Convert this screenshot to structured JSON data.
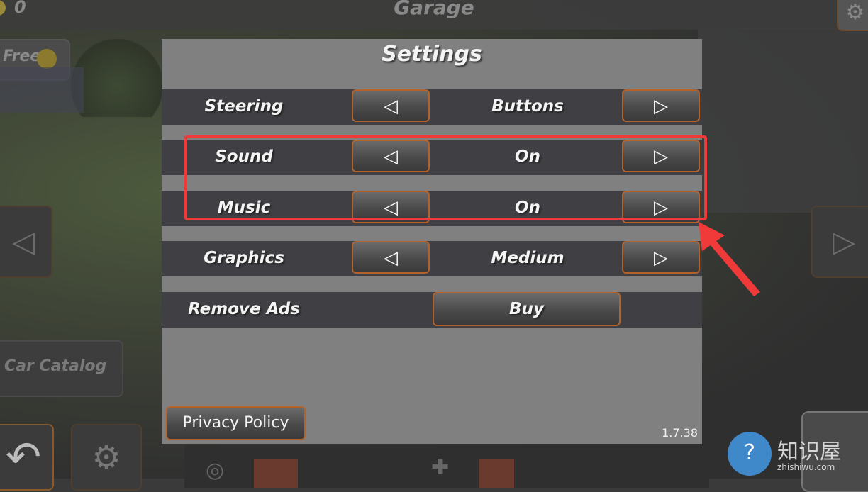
{
  "header": {
    "title": "Garage",
    "coins": "0"
  },
  "left": {
    "free_label": "Free",
    "car_catalog_label": "Car Catalog"
  },
  "settings": {
    "title": "Settings",
    "rows": [
      {
        "label": "Steering",
        "value": "Buttons"
      },
      {
        "label": "Sound",
        "value": "On"
      },
      {
        "label": "Music",
        "value": "On"
      },
      {
        "label": "Graphics",
        "value": "Medium"
      }
    ],
    "remove_ads_label": "Remove Ads",
    "buy_label": "Buy",
    "privacy_label": "Privacy Policy",
    "version": "1.7.38"
  },
  "icons": {
    "left_arrow": "◁",
    "right_arrow": "▷",
    "gear": "gear-icon",
    "back": "back-arrow-icon",
    "tire": "tire-icon"
  },
  "annotation": {
    "highlight_color": "#f03a3a"
  },
  "watermark": {
    "text": "知识屋",
    "sub": "zhishiwu.com"
  }
}
